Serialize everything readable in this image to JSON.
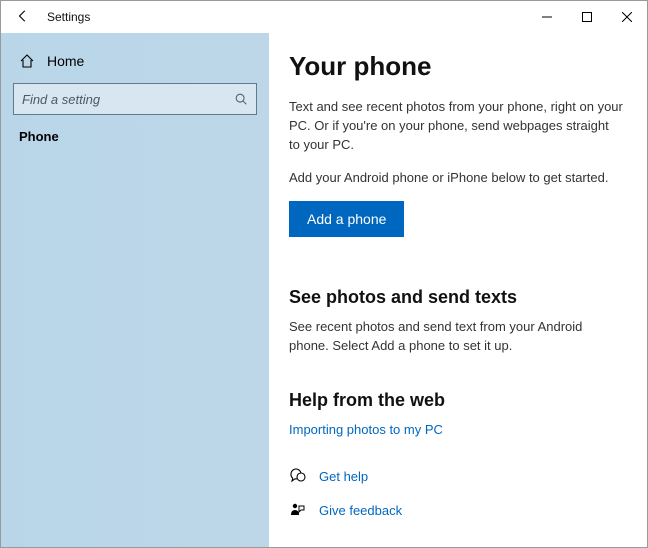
{
  "window": {
    "title": "Settings"
  },
  "sidebar": {
    "home_label": "Home",
    "search_placeholder": "Find a setting",
    "nav_selected": "Phone"
  },
  "main": {
    "heading": "Your phone",
    "desc1": "Text and see recent photos from your phone, right on your PC. Or if you're on your phone, send webpages straight to your PC.",
    "desc2": "Add your Android phone or iPhone below to get started.",
    "add_button": "Add a phone",
    "section_photos_heading": "See photos and send texts",
    "section_photos_desc": "See recent photos and send text from your Android phone. Select Add a phone to set it up.",
    "section_help_heading": "Help from the web",
    "help_link": "Importing photos to my PC",
    "get_help": "Get help",
    "give_feedback": "Give feedback"
  },
  "colors": {
    "accent": "#0067c0",
    "sidebar_bg": "#bdd7e8"
  }
}
